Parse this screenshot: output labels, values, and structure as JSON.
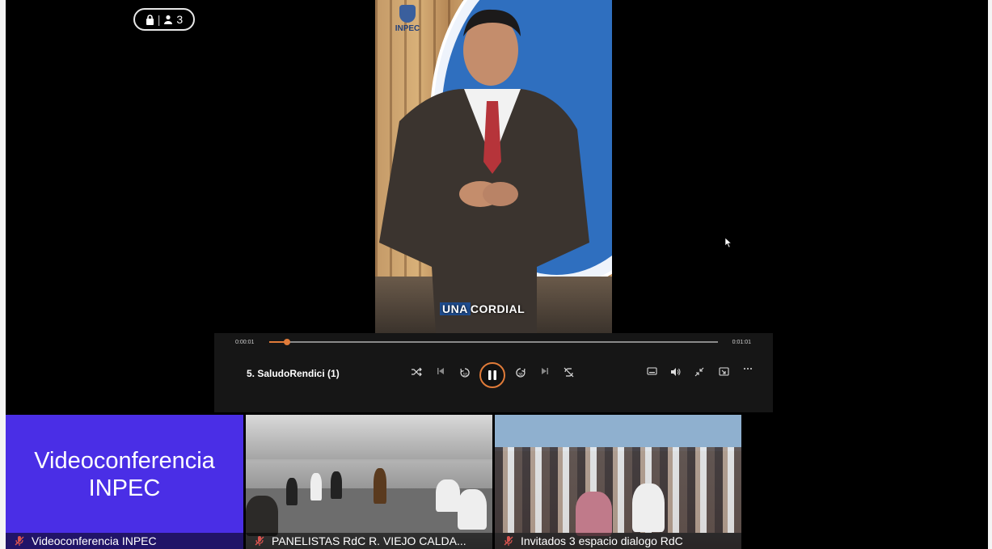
{
  "badge": {
    "count": "3",
    "icons": [
      "lock-icon",
      "person-icon"
    ]
  },
  "stage": {
    "watermark": "INPEC",
    "subtitle_highlight": "UNA",
    "subtitle_rest": "CORDIAL"
  },
  "player": {
    "current_time": "0:00:01",
    "total_time": "0:01:01",
    "progress_fraction": 0.04,
    "title": "5. SaludoRendici (1)",
    "accent_color": "#e07b39"
  },
  "tiles": [
    {
      "heading_line1": "Videoconferencia",
      "heading_line2": "INPEC",
      "label": "Videoconferencia INPEC",
      "bg": "#4a2ee6"
    },
    {
      "label": "PANELISTAS RdC R. VIEJO CALDA..."
    },
    {
      "label": "Invitados 3 espacio dialogo RdC"
    }
  ]
}
